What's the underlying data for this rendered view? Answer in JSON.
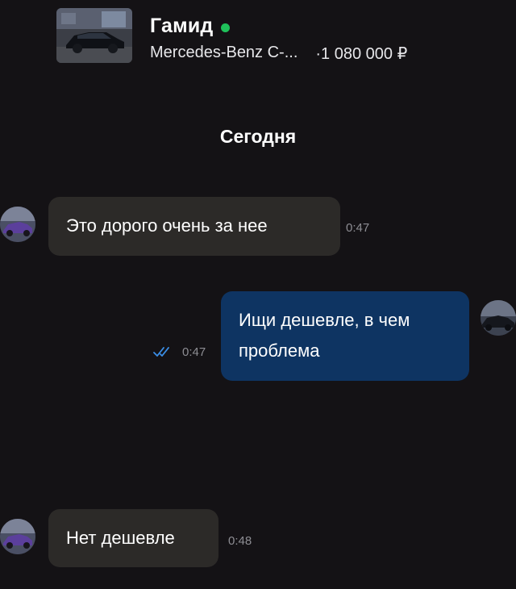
{
  "header": {
    "contact_name": "Гамид",
    "listing_title": "Mercedes-Benz C-...",
    "listing_price": "·1 080 000 ₽",
    "thumb_icon": "car-photo-icon",
    "online_color": "#1fc15a"
  },
  "chat": {
    "date_divider": "Сегодня",
    "messages": [
      {
        "direction": "incoming",
        "text": "Это дорого очень за нее",
        "time": "0:47"
      },
      {
        "direction": "outgoing",
        "text_line1": "Ищи дешевле, в чем",
        "text_line2": "проблема",
        "time": "0:47",
        "status_icon": "double-check-icon"
      },
      {
        "direction": "incoming",
        "text": "Нет дешевле",
        "time": "0:48"
      }
    ]
  },
  "colors": {
    "background": "#141215",
    "incoming_bubble": "#2c2a28",
    "outgoing_bubble": "#0e3462",
    "read_check": "#3b8fe8"
  }
}
